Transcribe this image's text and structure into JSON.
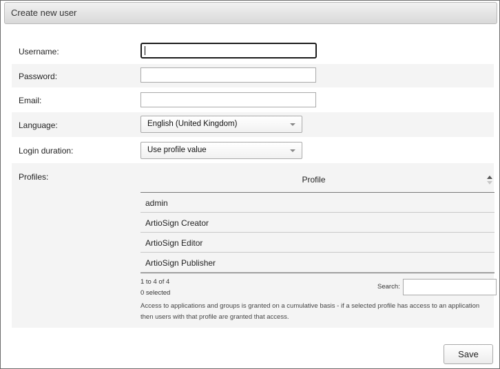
{
  "dialog": {
    "title": "Create new user"
  },
  "form": {
    "username_label": "Username:",
    "username_value": "",
    "password_label": "Password:",
    "password_value": "",
    "email_label": "Email:",
    "email_value": "",
    "language_label": "Language:",
    "language_value": "English (United Kingdom)",
    "login_duration_label": "Login duration:",
    "login_duration_value": "Use profile value",
    "profiles_label": "Profiles:"
  },
  "profiles_grid": {
    "column_header": "Profile",
    "rows": [
      "admin",
      "ArtioSign Creator",
      "ArtioSign Editor",
      "ArtioSign Publisher"
    ],
    "range_text": "1 to 4 of 4",
    "selected_text": "0 selected",
    "search_label": "Search:",
    "search_value": "",
    "note_line1": "Access to applications and groups is granted on a cumulative basis - if a selected profile has access to an application",
    "note_line2": "then users with that profile are granted that access."
  },
  "actions": {
    "save_label": "Save"
  },
  "icons": {
    "sort": "sort-icon",
    "dropdown": "chevron-down-icon"
  }
}
